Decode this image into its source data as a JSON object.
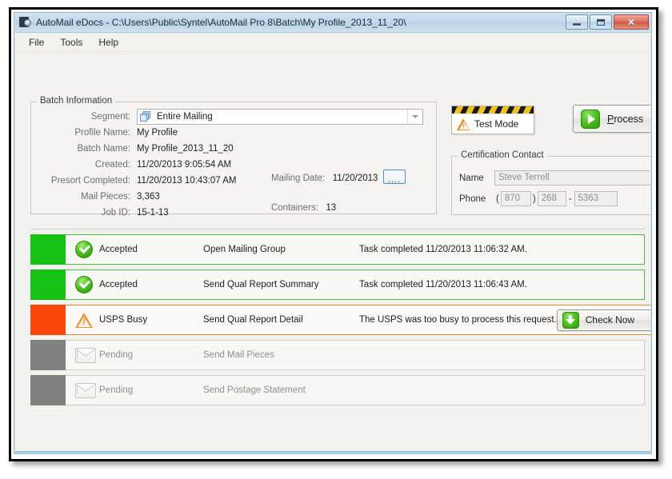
{
  "window": {
    "title": "AutoMail eDocs - C:\\Users\\Public\\Syntel\\AutoMail Pro 8\\Batch\\My Profile_2013_11_20\\",
    "app_icon": "automail-app-icon",
    "controls": {
      "minimize": "minimize-icon",
      "maximize": "maximize-icon",
      "close_glyph": "✕"
    }
  },
  "menubar": {
    "items": [
      {
        "label": "File"
      },
      {
        "label": "Tools"
      },
      {
        "label": "Help"
      }
    ]
  },
  "batch_information": {
    "title": "Batch Information",
    "segment": {
      "label": "Segment:",
      "value": "Entire Mailing",
      "icon": "stacked-layers-icon",
      "arrow": "chevron-down-icon"
    },
    "fields": [
      {
        "label": "Profile Name:",
        "value": "My Profile"
      },
      {
        "label": "Batch Name:",
        "value": "My Profile_2013_11_20"
      },
      {
        "label": "Created:",
        "value": "11/20/2013 9:05:54 AM"
      },
      {
        "label": "Presort Completed:",
        "value": "11/20/2013 10:43:07 AM"
      },
      {
        "label": "Mail Pieces:",
        "value": "3,363"
      },
      {
        "label": "Job ID:",
        "value": "15-1-13"
      }
    ],
    "mailing_date": {
      "label": "Mailing Date:",
      "value": "11/20/2013",
      "browse_label": "...."
    },
    "containers": {
      "label": "Containers:",
      "value": "13"
    }
  },
  "test_mode": {
    "label": "Test Mode",
    "icon": "warning-triangle-icon",
    "stripe_colors": {
      "dark": "#1a1a1a",
      "yellow": "#f2c21c"
    }
  },
  "process_button": {
    "label_before": "",
    "accesskey": "P",
    "label_after": "rocess",
    "icon": "green-right-arrow-icon",
    "accent": "#4fc21f"
  },
  "certification_contact": {
    "title": "Certification Contact",
    "name": {
      "label": "Name",
      "value": "Steve Terrell",
      "readonly": true
    },
    "phone": {
      "label": "Phone",
      "open_paren": "(",
      "close_paren": ")",
      "dash": "-",
      "area": "870",
      "prefix": "268",
      "line": "5363",
      "readonly": true
    }
  },
  "tasks": [
    {
      "state": "accepted",
      "status": "Accepted",
      "name": "Open Mailing Group",
      "message": "Task completed 11/20/2013 11:06:32 AM.",
      "icon": "green-check-circle-icon",
      "bar_color": "#17c217",
      "action": null
    },
    {
      "state": "accepted",
      "status": "Accepted",
      "name": "Send Qual Report Summary",
      "message": "Task completed 11/20/2013 11:06:43 AM.",
      "icon": "green-check-circle-icon",
      "bar_color": "#17c217",
      "action": null
    },
    {
      "state": "busy",
      "status": "USPS Busy",
      "name": "Send Qual Report Detail",
      "message": "The USPS was too busy to process this request.",
      "icon": "warning-triangle-icon",
      "bar_color": "#f9480a",
      "action": {
        "label": "Check Now",
        "icon": "green-download-arrow-icon"
      }
    },
    {
      "state": "pending",
      "status": "Pending",
      "name": "Send Mail Pieces",
      "message": "",
      "icon": "envelope-icon",
      "bar_color": "#808080",
      "action": null
    },
    {
      "state": "pending",
      "status": "Pending",
      "name": "Send Postage Statement",
      "message": "",
      "icon": "envelope-icon",
      "bar_color": "#808080",
      "action": null
    }
  ]
}
